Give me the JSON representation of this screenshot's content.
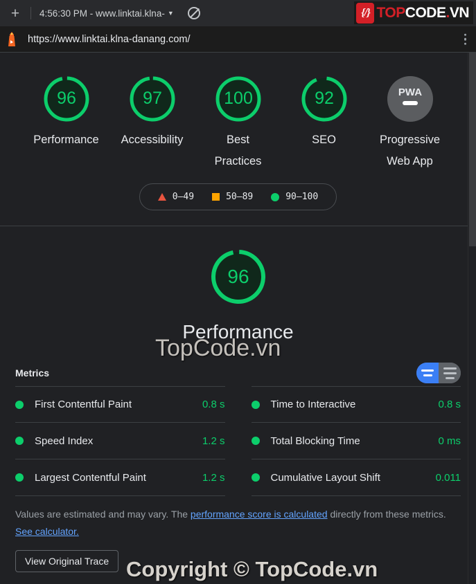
{
  "browser": {
    "new_tab_label": "+",
    "tab_title": "4:56:30 PM - www.linktai.klna-",
    "tab_caret": "▼",
    "block_icon": "no-entry-icon",
    "url": "https://www.linktai.klna-danang.com/",
    "menu_icon": "kebab-menu-icon",
    "lighthouse_icon": "lighthouse-icon"
  },
  "logo": {
    "badge": "{/}",
    "top": "TOP",
    "code": "CODE",
    "dot": ".",
    "vn": "VN"
  },
  "scores": [
    {
      "value": "96",
      "label": "Performance",
      "label2": "",
      "status": "pass"
    },
    {
      "value": "97",
      "label": "Accessibility",
      "label2": "",
      "status": "pass"
    },
    {
      "value": "100",
      "label": "Best",
      "label2": "Practices",
      "status": "pass"
    },
    {
      "value": "92",
      "label": "SEO",
      "label2": "",
      "status": "pass"
    },
    {
      "value": "PWA",
      "label": "Progressive",
      "label2": "Web App",
      "status": "na"
    }
  ],
  "legend": [
    {
      "shape": "triangle-icon",
      "range": "0–49",
      "color": "#e8543f"
    },
    {
      "shape": "square-icon",
      "range": "50–89",
      "color": "#ffa400"
    },
    {
      "shape": "circle-icon",
      "range": "90–100",
      "color": "#0cce6b"
    }
  ],
  "category": {
    "score": "96",
    "title": "Performance"
  },
  "metrics": {
    "heading": "Metrics",
    "toggle": {
      "expand_view": "expanded-rows-icon",
      "collapse_view": "collapsed-rows-icon"
    },
    "left": [
      {
        "name": "First Contentful Paint",
        "value": "0.8 s",
        "status": "pass"
      },
      {
        "name": "Speed Index",
        "value": "1.2 s",
        "status": "pass"
      },
      {
        "name": "Largest Contentful Paint",
        "value": "1.2 s",
        "status": "pass"
      }
    ],
    "right": [
      {
        "name": "Time to Interactive",
        "value": "0.8 s",
        "status": "pass"
      },
      {
        "name": "Total Blocking Time",
        "value": "0 ms",
        "status": "pass"
      },
      {
        "name": "Cumulative Layout Shift",
        "value": "0.011",
        "status": "pass"
      }
    ]
  },
  "footer": {
    "text_1": "Values are estimated and may vary. The ",
    "link_1": "performance score is calculated",
    "text_2": " directly from these metrics. ",
    "link_2": "See calculator.",
    "trace_button": "View Original Trace"
  },
  "watermarks": {
    "top": "TopCode.vn",
    "bottom": "Copyright © TopCode.vn"
  },
  "colors": {
    "pass": "#0cce6b",
    "average": "#ffa400",
    "fail": "#e8543f",
    "accent": "#3b7ff5",
    "background": "#202124"
  }
}
